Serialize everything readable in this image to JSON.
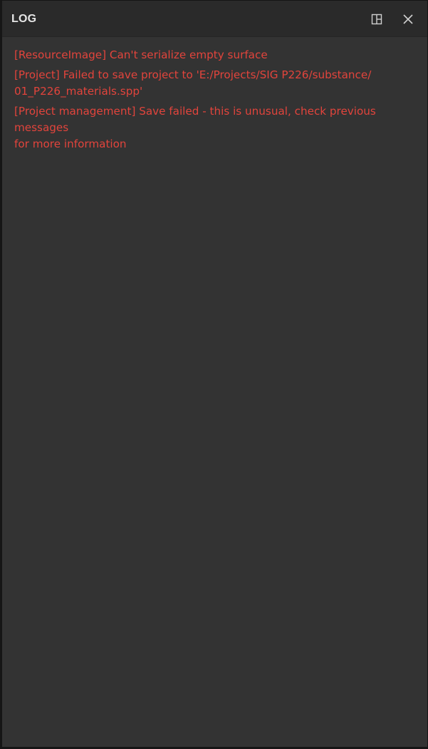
{
  "panel": {
    "title": "LOG",
    "icons": {
      "layout": "layout-icon",
      "close": "close-icon"
    },
    "colors": {
      "background": "#333333",
      "titlebar": "#2a2a2a",
      "title_text": "#e6e6e6",
      "error_text": "#e2443c"
    }
  },
  "log": {
    "entries": [
      {
        "line1": "[ResourceImage] Can't serialize empty surface",
        "line2": ""
      },
      {
        "line1": "[Project] Failed to save project to 'E:/Projects/SIG P226/substance/",
        "line2": "01_P226_materials.spp'"
      },
      {
        "line1": "[Project management] Save failed - this is unusual, check previous messages",
        "line2": "for more information"
      }
    ]
  }
}
